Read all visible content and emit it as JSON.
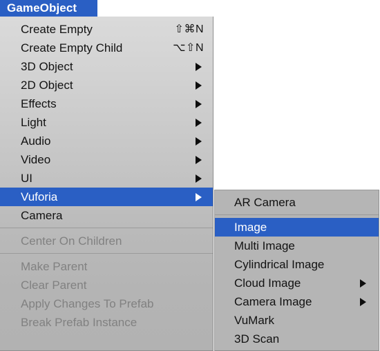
{
  "menubar": {
    "title": "GameObject"
  },
  "colors": {
    "highlight_blue": "#2a5fc4",
    "menu_gray": "#b5b5b5",
    "text": "#121212",
    "disabled_text": "#818181",
    "selected_text": "#ffffff"
  },
  "main_menu": {
    "items": [
      {
        "label": "Create Empty",
        "shortcut": "⇧⌘N",
        "submenu": false,
        "disabled": false,
        "selected": false
      },
      {
        "label": "Create Empty Child",
        "shortcut": "⌥⇧N",
        "submenu": false,
        "disabled": false,
        "selected": false
      },
      {
        "label": "3D Object",
        "shortcut": "",
        "submenu": true,
        "disabled": false,
        "selected": false
      },
      {
        "label": "2D Object",
        "shortcut": "",
        "submenu": true,
        "disabled": false,
        "selected": false
      },
      {
        "label": "Effects",
        "shortcut": "",
        "submenu": true,
        "disabled": false,
        "selected": false
      },
      {
        "label": "Light",
        "shortcut": "",
        "submenu": true,
        "disabled": false,
        "selected": false
      },
      {
        "label": "Audio",
        "shortcut": "",
        "submenu": true,
        "disabled": false,
        "selected": false
      },
      {
        "label": "Video",
        "shortcut": "",
        "submenu": true,
        "disabled": false,
        "selected": false
      },
      {
        "label": "UI",
        "shortcut": "",
        "submenu": true,
        "disabled": false,
        "selected": false
      },
      {
        "label": "Vuforia",
        "shortcut": "",
        "submenu": true,
        "disabled": false,
        "selected": true
      },
      {
        "label": "Camera",
        "shortcut": "",
        "submenu": false,
        "disabled": false,
        "selected": false
      },
      {
        "separator": true
      },
      {
        "label": "Center On Children",
        "shortcut": "",
        "submenu": false,
        "disabled": true,
        "selected": false
      },
      {
        "separator": true
      },
      {
        "label": "Make Parent",
        "shortcut": "",
        "submenu": false,
        "disabled": true,
        "selected": false
      },
      {
        "label": "Clear Parent",
        "shortcut": "",
        "submenu": false,
        "disabled": true,
        "selected": false
      },
      {
        "label": "Apply Changes To Prefab",
        "shortcut": "",
        "submenu": false,
        "disabled": true,
        "selected": false
      },
      {
        "label": "Break Prefab Instance",
        "shortcut": "",
        "submenu": false,
        "disabled": true,
        "selected": false
      }
    ]
  },
  "sub_menu": {
    "parent": "Vuforia",
    "items": [
      {
        "label": "AR Camera",
        "submenu": false,
        "disabled": false,
        "selected": false
      },
      {
        "separator": true
      },
      {
        "label": "Image",
        "submenu": false,
        "disabled": false,
        "selected": true
      },
      {
        "label": "Multi Image",
        "submenu": false,
        "disabled": false,
        "selected": false
      },
      {
        "label": "Cylindrical Image",
        "submenu": false,
        "disabled": false,
        "selected": false
      },
      {
        "label": "Cloud Image",
        "submenu": true,
        "disabled": false,
        "selected": false
      },
      {
        "label": "Camera Image",
        "submenu": true,
        "disabled": false,
        "selected": false
      },
      {
        "label": "VuMark",
        "submenu": false,
        "disabled": false,
        "selected": false
      },
      {
        "label": "3D Scan",
        "submenu": false,
        "disabled": false,
        "selected": false
      }
    ]
  }
}
